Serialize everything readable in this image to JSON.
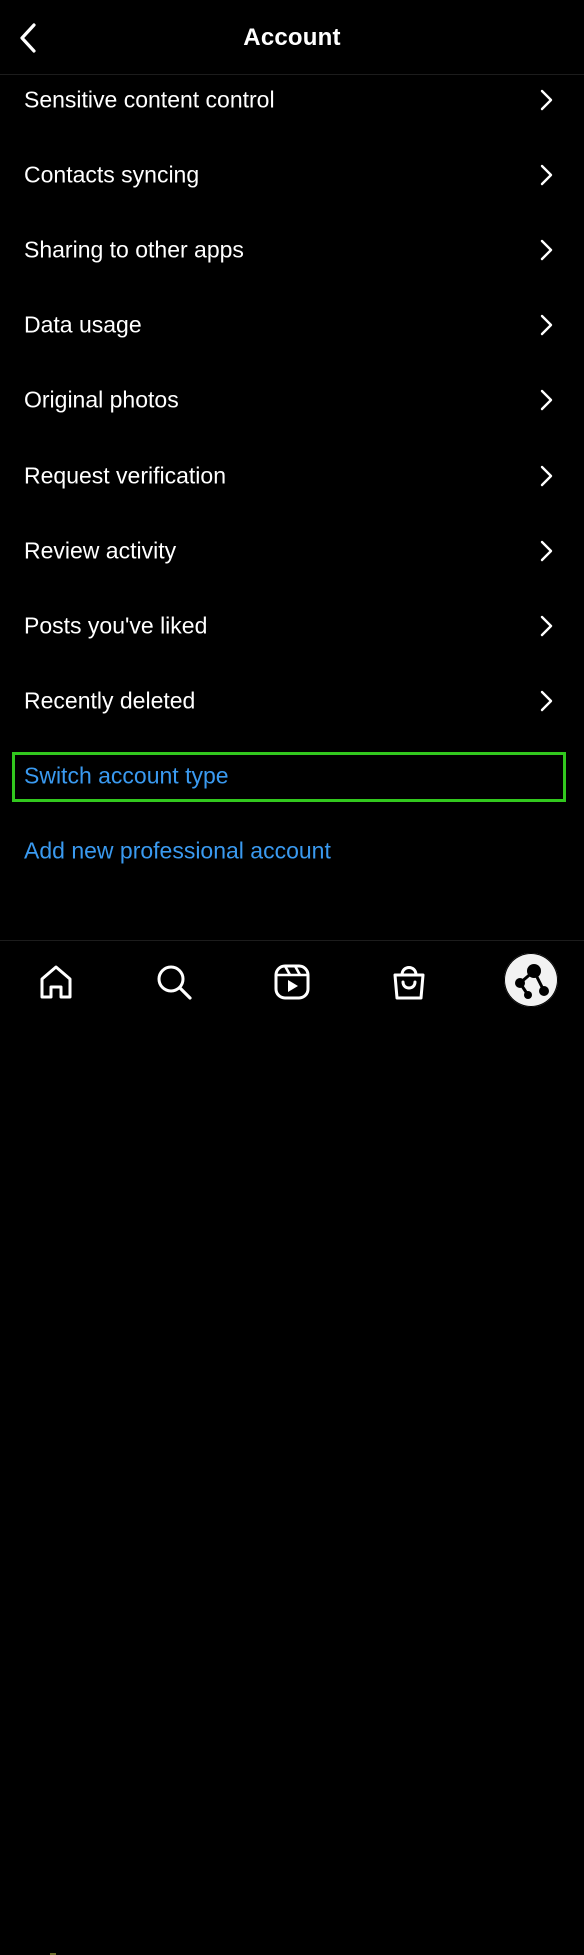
{
  "header": {
    "title": "Account",
    "back_icon": "chevron-left-icon"
  },
  "menu": {
    "items": [
      {
        "label": "Sensitive content control"
      },
      {
        "label": "Contacts syncing"
      },
      {
        "label": "Sharing to other apps"
      },
      {
        "label": "Data usage"
      },
      {
        "label": "Original photos"
      },
      {
        "label": "Request verification"
      },
      {
        "label": "Review activity"
      },
      {
        "label": "Posts you've liked"
      },
      {
        "label": "Recently deleted"
      }
    ],
    "links": [
      {
        "label": "Switch account type",
        "highlighted": true
      },
      {
        "label": "Add new professional account",
        "highlighted": false
      }
    ]
  },
  "tabbar": {
    "tabs": [
      "home-icon",
      "search-icon",
      "reels-icon",
      "shop-icon",
      "profile-avatar"
    ]
  },
  "colors": {
    "background": "#000000",
    "text": "#ffffff",
    "link": "#3a9af0",
    "highlight": "#32c81e"
  }
}
